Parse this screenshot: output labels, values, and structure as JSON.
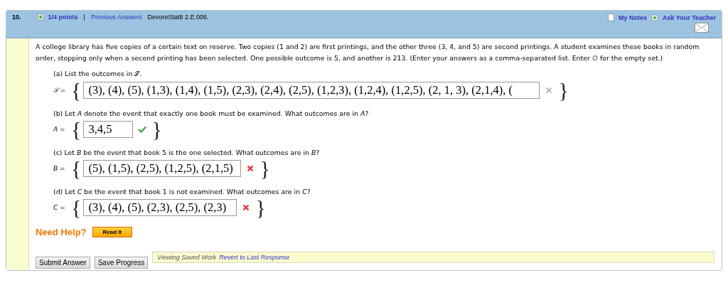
{
  "header": {
    "number": "10.",
    "points": "1/4 points",
    "separator": "|",
    "previous_answers": "Previous Answers",
    "problem_id": "DevoreStat8 2.E.006.",
    "my_notes": "My Notes",
    "ask_teacher": "Ask Your Teacher"
  },
  "prompt": "A college library has five copies of a certain text on reserve. Two copies (1 and 2) are first printings, and the other three (3, 4, and 5) are second printings. A student examines these books in random order, stopping only when a second printing has been selected. One possible outcome is 5, and another is 213. (Enter your answers as a comma-separated list. Enter ∅ for the empty set.)",
  "parts": [
    {
      "label": "(a) List the outcomes in 𝒮.",
      "symbol": "𝒮 =",
      "open_brace": "{",
      "value": "(3), (4), (5), (1,3), (1,4), (1,5), (2,3), (2,4), (2,5), (1,2,3), (1,2,4), (1,2,5), (2, 1, 3), (2,1,4), (",
      "close_brace": "}",
      "kind": "unmarked"
    },
    {
      "label": "(b) Let *A* denote the event that exactly one book must be examined. What outcomes are in *A*?",
      "symbol": "A =",
      "open_brace": "{",
      "value": "3,4,5",
      "close_brace": "}",
      "kind": "correct"
    },
    {
      "label": "(c) Let *B* be the event that book 5 is the one selected. What outcomes are in *B*?",
      "symbol": "B =",
      "open_brace": "{",
      "value": "(5), (1,5), (2,5), (1,2,5), (2,1,5)",
      "close_brace": "}",
      "kind": "incorrect"
    },
    {
      "label": "(d) Let *C* be the event that book 1 is not examined. What outcomes are in *C*?",
      "symbol": "C =",
      "open_brace": "{",
      "value": "(3), (4), (5), (2,3), (2,5), (2,3)",
      "close_brace": "}",
      "kind": "incorrect"
    }
  ],
  "help": {
    "label": "Need Help?",
    "button": "Read It"
  },
  "buttons": [
    "Submit Answer",
    "Save Progress"
  ],
  "saved_notice": {
    "text": "Viewing Saved Work",
    "link": "Revert to Last Response"
  }
}
